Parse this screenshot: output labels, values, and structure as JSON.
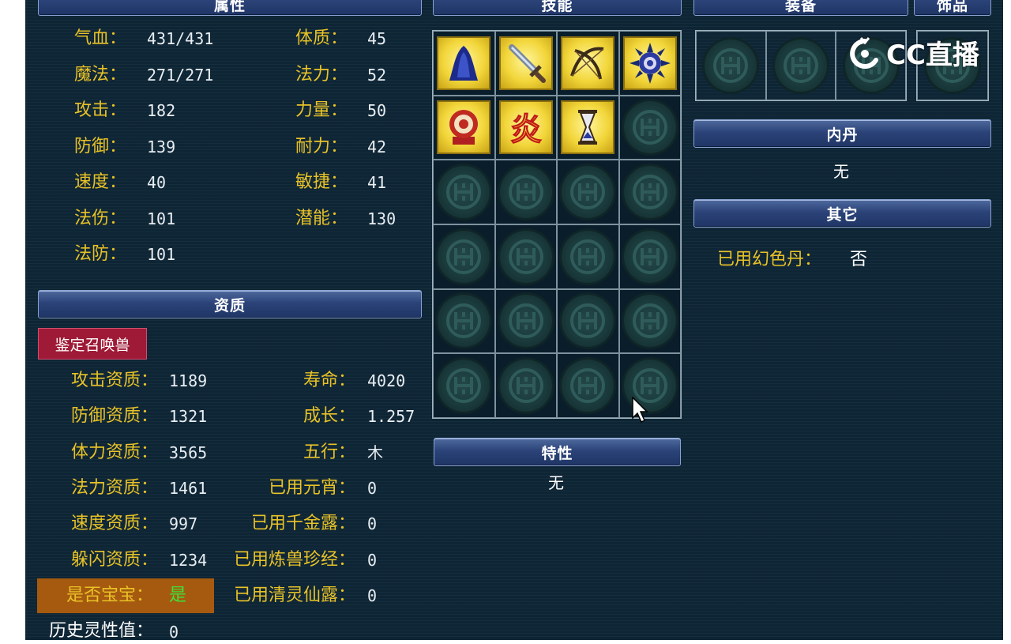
{
  "headers": {
    "attributes": "属性",
    "skills": "技能",
    "equipment": "装备",
    "accessory": "饰品",
    "aptitude": "资质",
    "traits": "特性",
    "inner_core": "内丹",
    "others": "其它"
  },
  "attributes": {
    "left": [
      {
        "label": "气血：",
        "value": "431/431"
      },
      {
        "label": "魔法：",
        "value": "271/271"
      },
      {
        "label": "攻击：",
        "value": "182"
      },
      {
        "label": "防御：",
        "value": "139"
      },
      {
        "label": "速度：",
        "value": "40"
      },
      {
        "label": "法伤：",
        "value": "101"
      },
      {
        "label": "法防：",
        "value": "101"
      }
    ],
    "right": [
      {
        "label": "体质：",
        "value": "45"
      },
      {
        "label": "法力：",
        "value": "52"
      },
      {
        "label": "力量：",
        "value": "50"
      },
      {
        "label": "耐力：",
        "value": "42"
      },
      {
        "label": "敏捷：",
        "value": "41"
      },
      {
        "label": "潜能：",
        "value": "130"
      }
    ]
  },
  "aptitude": {
    "identify_button": "鉴定召唤兽",
    "left": [
      {
        "label": "攻击资质：",
        "value": "1189"
      },
      {
        "label": "防御资质：",
        "value": "1321"
      },
      {
        "label": "体力资质：",
        "value": "3565"
      },
      {
        "label": "法力资质：",
        "value": "1461"
      },
      {
        "label": "速度资质：",
        "value": "997"
      },
      {
        "label": "躲闪资质：",
        "value": "1234"
      }
    ],
    "right": [
      {
        "label": "寿命：",
        "value": "4020"
      },
      {
        "label": "成长：",
        "value": "1.257"
      },
      {
        "label": "五行：",
        "value": "木"
      },
      {
        "label": "已用元宵：",
        "value": "0"
      },
      {
        "label": "已用千金露：",
        "value": "0"
      },
      {
        "label": "已用炼兽珍经：",
        "value": "0"
      },
      {
        "label": "已用清灵仙露：",
        "value": "0"
      }
    ],
    "is_baby_label": "是否宝宝：",
    "is_baby_value": "是",
    "history_label": "历史灵性值：",
    "history_value": "0"
  },
  "skills": {
    "icons": [
      "hooded-figure-skill-icon",
      "sword-skill-icon",
      "crossed-bows-skill-icon",
      "spiked-orb-skill-icon",
      "round-seal-skill-icon",
      "flame-character-skill-icon",
      "hourglass-skill-icon"
    ],
    "empty_slot_count": 17,
    "flame_glyph": "炎"
  },
  "traits_value": "无",
  "inner_core_value": "无",
  "others": {
    "label": "已用幻色丹：",
    "value": "否"
  },
  "watermark": "CC直播",
  "colors": {
    "label": "#e8c227",
    "value": "#e8eef2",
    "header": "#2b4378",
    "baby_yes": "#3fe03a",
    "identify_button": "#9e1a36"
  }
}
